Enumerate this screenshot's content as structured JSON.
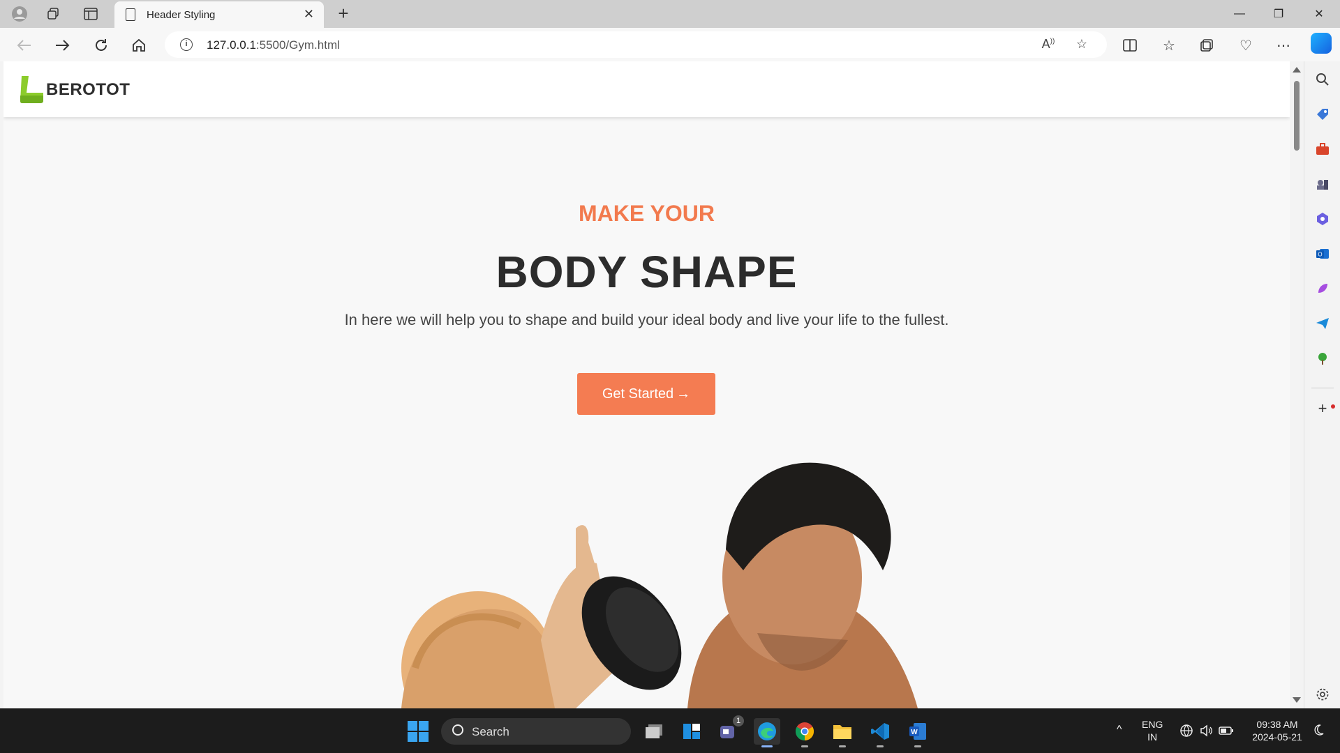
{
  "browser": {
    "tab_title": "Header Styling",
    "tab_close": "✕",
    "new_tab": "+",
    "url_host": "127.0.0.1",
    "url_path": ":5500/Gym.html",
    "window_controls": {
      "minimize": "—",
      "restore": "❐",
      "close": "✕"
    }
  },
  "site": {
    "logo_text": "BEROTOT",
    "hero": {
      "kicker": "MAKE YOUR",
      "title": "BODY SHAPE",
      "subtitle": "In here we will help you to shape and build your ideal body and live your life to the fullest.",
      "cta_label": "Get Started",
      "cta_arrow": "→"
    }
  },
  "taskbar": {
    "search_placeholder": "Search",
    "teams_badge": "1",
    "lang_line1": "ENG",
    "lang_line2": "IN",
    "time": "09:38 AM",
    "date": "2024-05-21"
  },
  "colors": {
    "accent": "#f47c52",
    "logo_green": "#8ccc2c",
    "title_dark": "#2c2c2c"
  }
}
